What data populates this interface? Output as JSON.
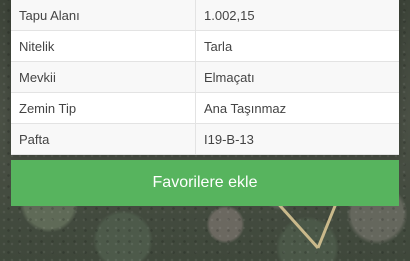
{
  "info_rows": [
    {
      "label": "Tapu Alanı",
      "value": "1.002,15"
    },
    {
      "label": "Nitelik",
      "value": "Tarla"
    },
    {
      "label": "Mevkii",
      "value": "Elmaçatı"
    },
    {
      "label": "Zemin Tip",
      "value": "Ana Taşınmaz"
    },
    {
      "label": "Pafta",
      "value": "I19-B-13"
    }
  ],
  "actions": {
    "favorite_label": "Favorilere ekle"
  },
  "colors": {
    "button_green": "#57b45e",
    "card_white": "#ffffff",
    "outline": "#c9b98b"
  }
}
